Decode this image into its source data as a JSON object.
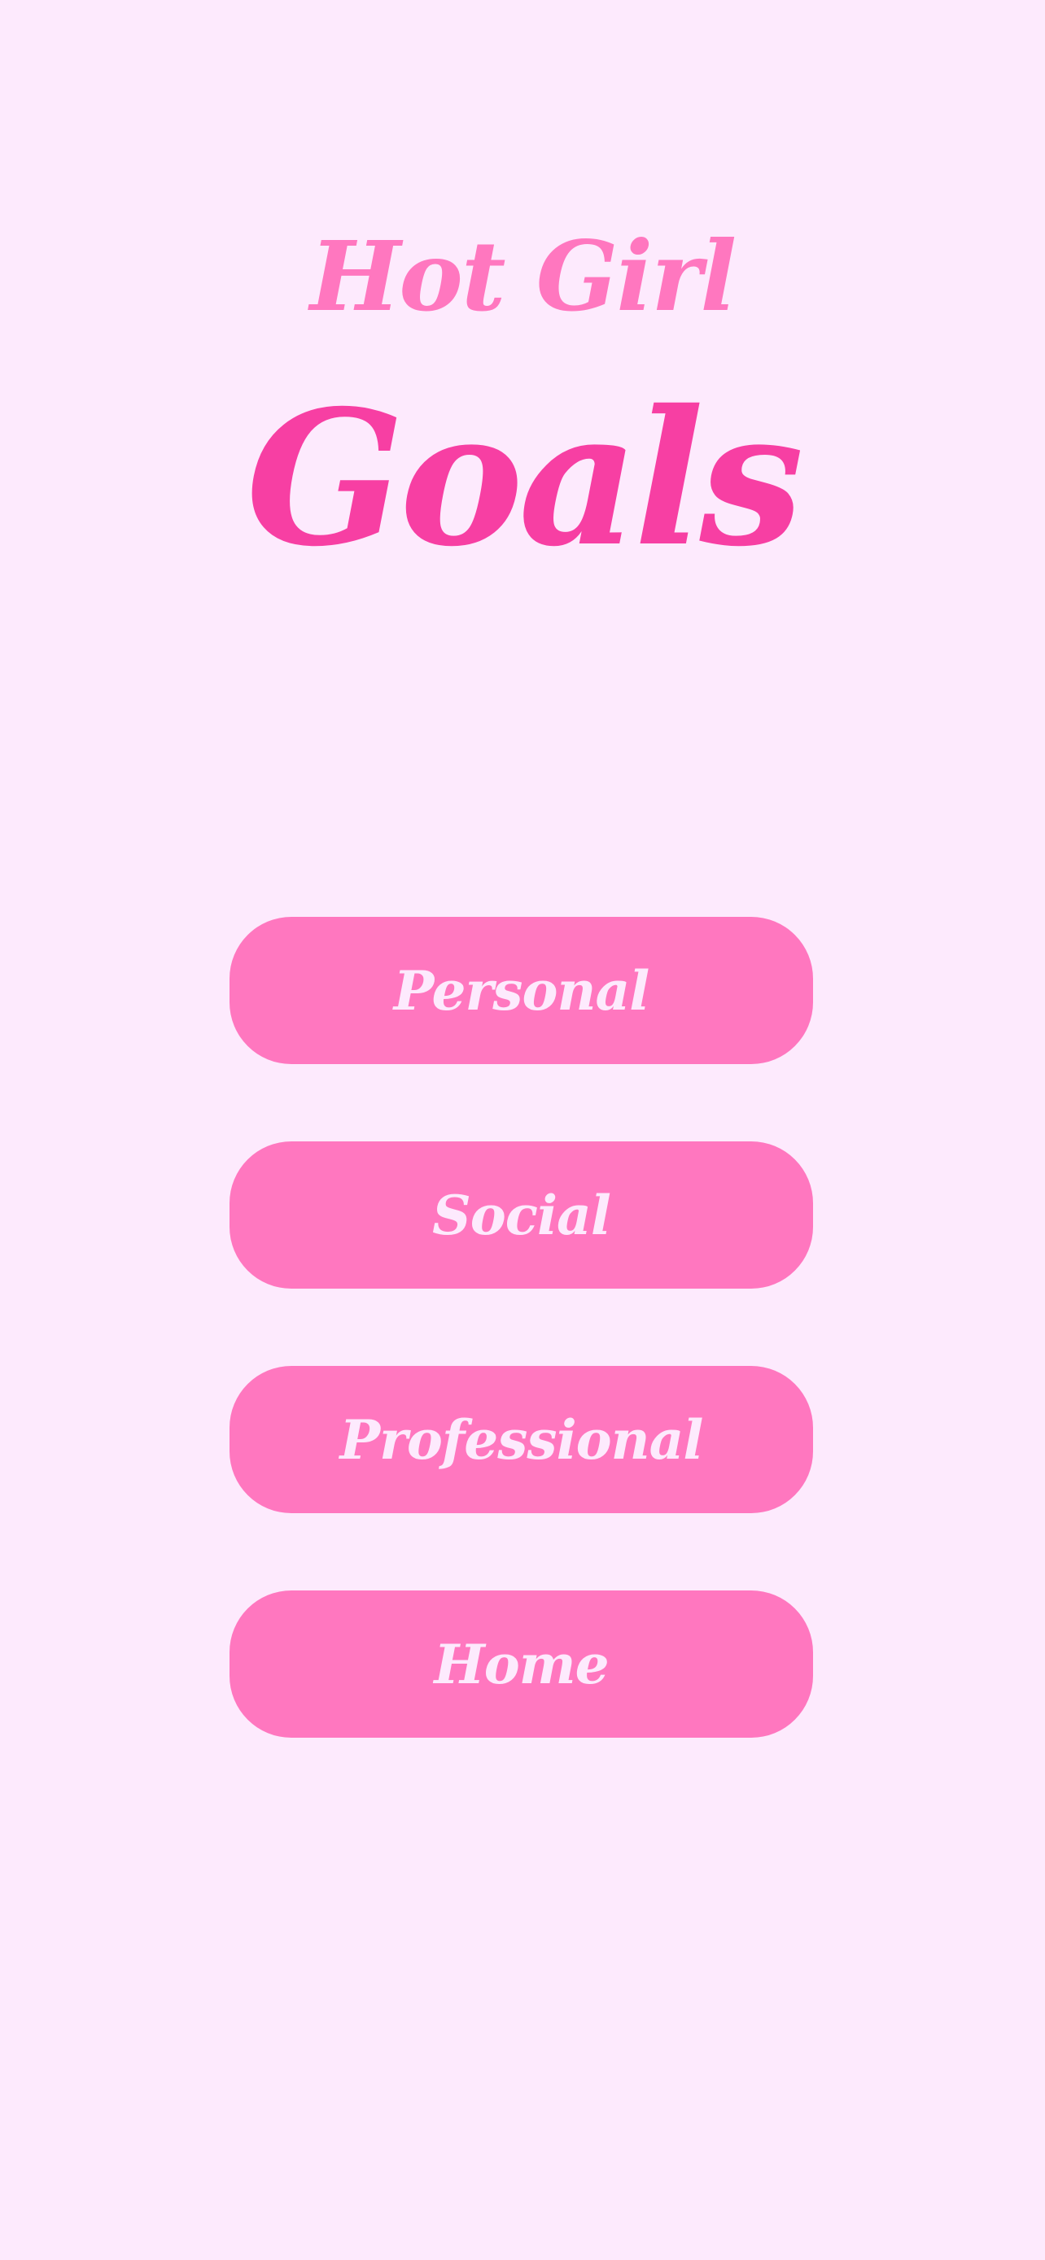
{
  "header": {
    "title_line1": "Hot Girl",
    "title_line2": "Goals"
  },
  "menu": {
    "items": [
      {
        "label": "Personal"
      },
      {
        "label": "Social"
      },
      {
        "label": "Professional"
      },
      {
        "label": "Home"
      }
    ]
  },
  "colors": {
    "background": "#fdeafd",
    "title_light": "#ff77bf",
    "title_dark": "#f73fa3",
    "button": "#ff77bf",
    "button_text": "#fdeafd"
  }
}
